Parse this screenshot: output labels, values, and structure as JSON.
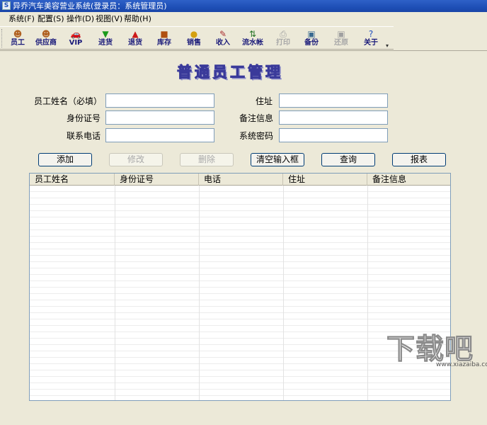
{
  "window": {
    "title": "异乔汽车美容营业系统(登录员：系统管理员)",
    "icon_glyph": "S"
  },
  "menubar": [
    {
      "label": "系统(F)"
    },
    {
      "label": "配置(S)"
    },
    {
      "label": "操作(D)"
    },
    {
      "label": "视图(V)"
    },
    {
      "label": "帮助(H)"
    }
  ],
  "toolbar": [
    {
      "label": "员工",
      "icon": "employee-icon",
      "glyph": "☻",
      "color": "#b06020",
      "enabled": true
    },
    {
      "label": "供应商",
      "icon": "supplier-icon",
      "glyph": "☻",
      "color": "#b06020",
      "enabled": true
    },
    {
      "label": "VIP",
      "icon": "car-icon",
      "glyph": "🚗",
      "color": "#555555",
      "enabled": true
    },
    {
      "label": "进货",
      "icon": "arrow-down-icon",
      "glyph": "▼",
      "color": "#1a9a1a",
      "enabled": true
    },
    {
      "label": "退货",
      "icon": "arrow-up-icon",
      "glyph": "▲",
      "color": "#cc1a1a",
      "enabled": true
    },
    {
      "label": "库存",
      "icon": "inventory-icon",
      "glyph": "■",
      "color": "#b05010",
      "enabled": true
    },
    {
      "label": "销售",
      "icon": "coin-icon",
      "glyph": "●",
      "color": "#d4a010",
      "enabled": true
    },
    {
      "label": "收入",
      "icon": "income-icon",
      "glyph": "✎",
      "color": "#aa3030",
      "enabled": true
    },
    {
      "label": "流水帐",
      "icon": "ledger-icon",
      "glyph": "⇅",
      "color": "#207020",
      "enabled": true
    },
    {
      "label": "打印",
      "icon": "printer-icon",
      "glyph": "⎙",
      "color": "#a0a0a0",
      "enabled": false
    },
    {
      "label": "备份",
      "icon": "backup-icon",
      "glyph": "▣",
      "color": "#3a6a90",
      "enabled": true
    },
    {
      "label": "还原",
      "icon": "restore-icon",
      "glyph": "▣",
      "color": "#a0a0a0",
      "enabled": false
    },
    {
      "label": "关于",
      "icon": "help-icon",
      "glyph": "?",
      "color": "#2050c0",
      "enabled": true
    }
  ],
  "form": {
    "title": "普通员工管理",
    "fields": {
      "name": {
        "label": "员工姓名（必填）",
        "value": ""
      },
      "id_number": {
        "label": "身份证号",
        "value": ""
      },
      "phone": {
        "label": "联系电话",
        "value": ""
      },
      "address": {
        "label": "住址",
        "value": ""
      },
      "remarks": {
        "label": "备注信息",
        "value": ""
      },
      "password": {
        "label": "系统密码",
        "value": ""
      }
    },
    "buttons": {
      "add": {
        "label": "添加",
        "enabled": true
      },
      "modify": {
        "label": "修改",
        "enabled": false
      },
      "delete": {
        "label": "删除",
        "enabled": false
      },
      "clear": {
        "label": "清空输入框",
        "enabled": true
      },
      "query": {
        "label": "查询",
        "enabled": true
      },
      "report": {
        "label": "报表",
        "enabled": true
      }
    }
  },
  "grid": {
    "columns": [
      "员工姓名",
      "身份证号",
      "电话",
      "住址",
      "备注信息"
    ],
    "rows": []
  },
  "watermark": {
    "text": "下载吧",
    "url": "www.xiazaiba.com"
  }
}
